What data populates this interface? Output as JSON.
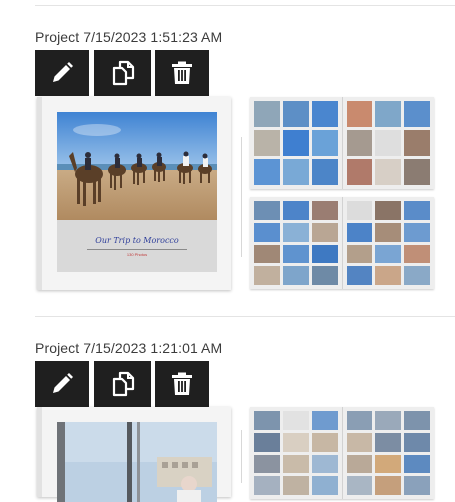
{
  "projects": [
    {
      "title": "Project 7/15/2023 1:51:23 AM",
      "cover": {
        "title": "Our Trip to Morocco",
        "subtitle": "130 Photos"
      },
      "actions": [
        "edit-icon",
        "duplicate-icon",
        "delete-icon"
      ]
    },
    {
      "title": "Project 7/15/2023 1:21:01 AM",
      "actions": [
        "edit-icon",
        "duplicate-icon",
        "delete-icon"
      ]
    }
  ],
  "colors": {
    "button_bg": "#1f1f1f",
    "icon": "#ffffff",
    "cover_title": "#2f3f9a",
    "cover_subtitle": "#c03a3a"
  }
}
